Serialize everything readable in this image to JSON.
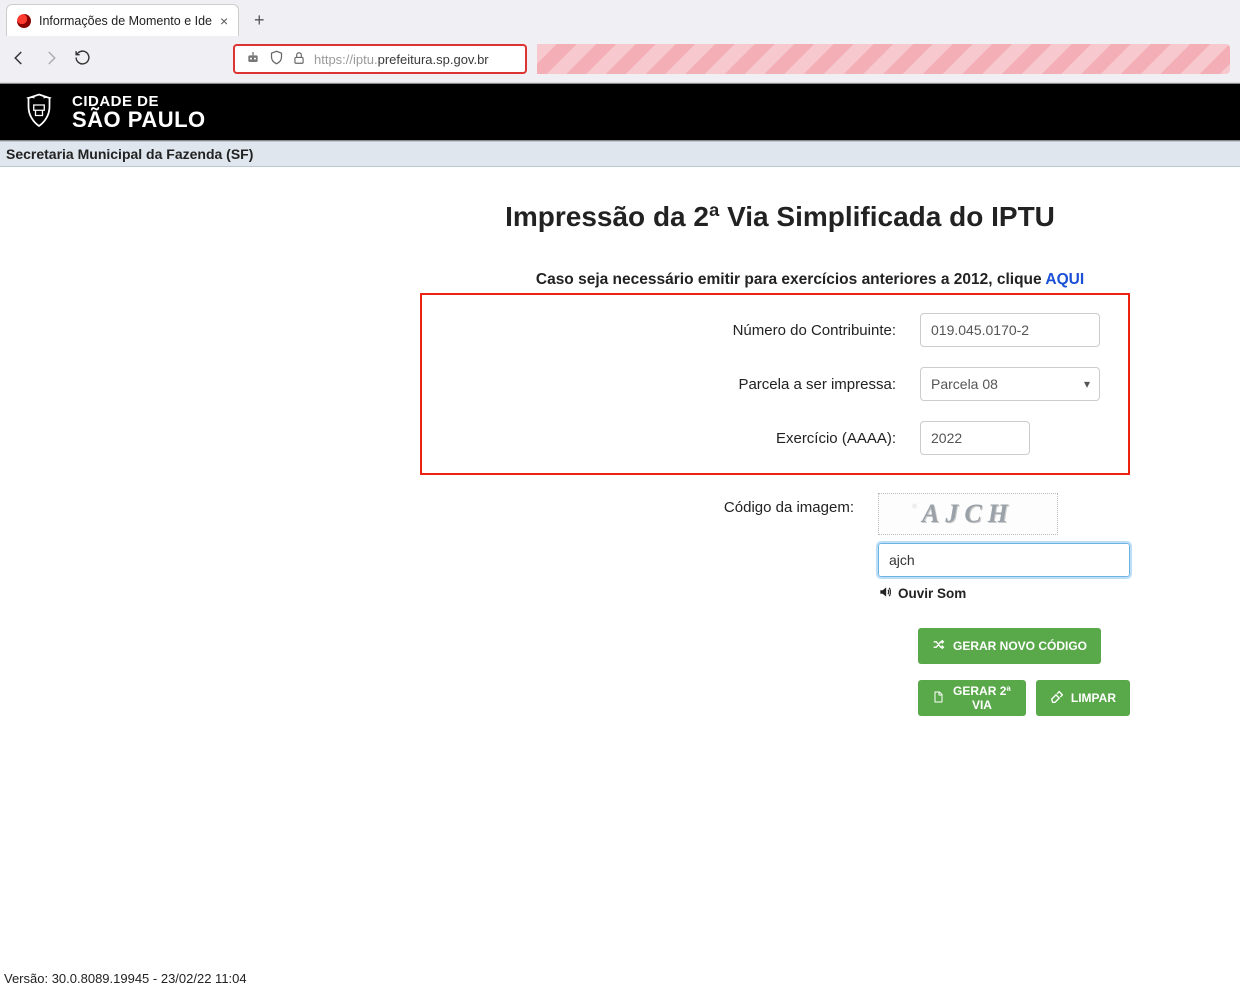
{
  "browser": {
    "tab_title": "Informações de Momento e Ide",
    "url_faded1": "https://iptu.",
    "url_strong": "prefeitura.sp.gov.br",
    "url_faded2": ""
  },
  "header": {
    "line1": "CIDADE DE",
    "line2": "SÃO PAULO",
    "sub": "Secretaria Municipal da Fazenda (SF)"
  },
  "page": {
    "title": "Impressão da 2ª Via Simplificada do IPTU",
    "notice_pre": "Caso seja necessário emitir para exercícios anteriores a 2012, clique ",
    "notice_link": "AQUI"
  },
  "form": {
    "contribuinte_label": "Número do Contribuinte:",
    "contribuinte_value": "019.045.0170-2",
    "parcela_label": "Parcela a ser impressa:",
    "parcela_value": "Parcela 08",
    "exercicio_label": "Exercício (AAAA):",
    "exercicio_value": "2022",
    "captcha_label": "Código da imagem:",
    "captcha_text": "AJCH",
    "captcha_input": "ajch",
    "ouvir": "Ouvir Som"
  },
  "buttons": {
    "novo_codigo": "GERAR NOVO CÓDIGO",
    "gerar": "GERAR 2ª VIA",
    "limpar": "LIMPAR"
  },
  "footer": {
    "version": "Versão: 30.0.8089.19945 - 23/02/22 11:04"
  }
}
